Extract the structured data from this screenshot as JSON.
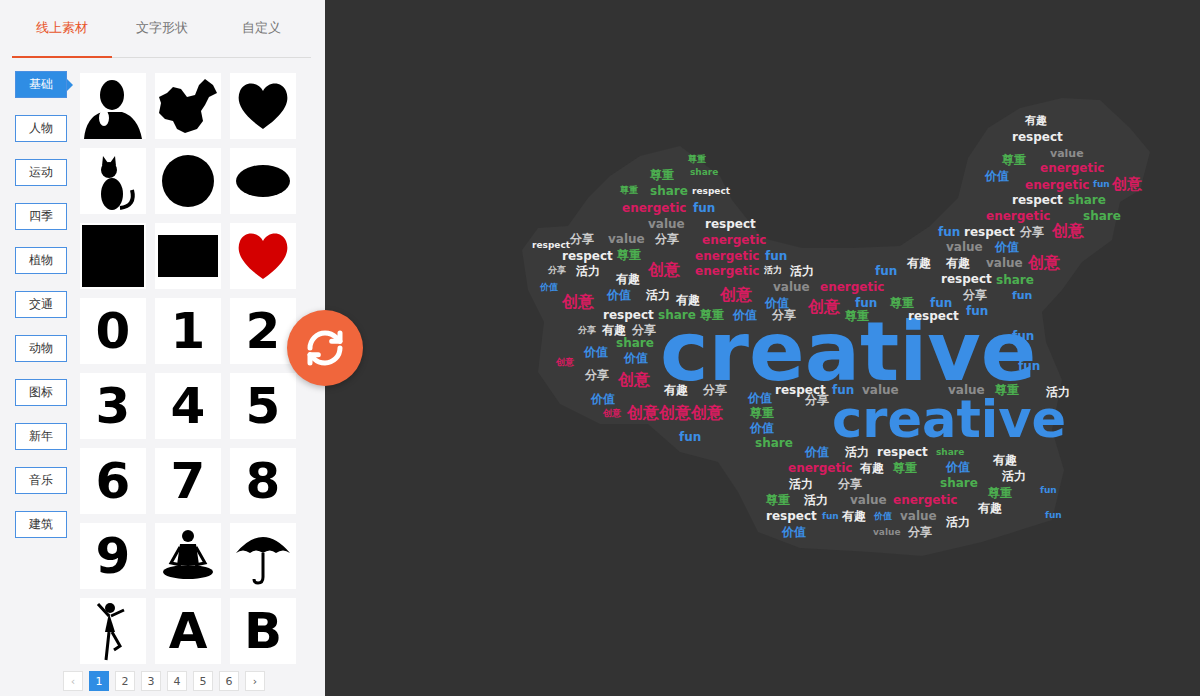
{
  "tabs": [
    {
      "label": "线上素材",
      "selected": true
    },
    {
      "label": "文字形状",
      "selected": false
    },
    {
      "label": "自定义",
      "selected": false
    }
  ],
  "categories": [
    {
      "label": "基础",
      "selected": true
    },
    {
      "label": "人物",
      "selected": false
    },
    {
      "label": "运动",
      "selected": false
    },
    {
      "label": "四季",
      "selected": false
    },
    {
      "label": "植物",
      "selected": false
    },
    {
      "label": "交通",
      "selected": false
    },
    {
      "label": "动物",
      "selected": false
    },
    {
      "label": "图标",
      "selected": false
    },
    {
      "label": "新年",
      "selected": false
    },
    {
      "label": "音乐",
      "selected": false
    },
    {
      "label": "建筑",
      "selected": false
    }
  ],
  "shapes": [
    {
      "kind": "person",
      "color": "#000000"
    },
    {
      "kind": "map",
      "color": "#000000"
    },
    {
      "kind": "heart",
      "color": "#000000"
    },
    {
      "kind": "cat",
      "color": "#000000"
    },
    {
      "kind": "circle",
      "color": "#000000"
    },
    {
      "kind": "ellipse",
      "color": "#000000"
    },
    {
      "kind": "square",
      "color": "#000000"
    },
    {
      "kind": "rect",
      "color": "#000000"
    },
    {
      "kind": "heart",
      "color": "#d40000"
    },
    {
      "kind": "glyph",
      "text": "0",
      "color": "#000000"
    },
    {
      "kind": "glyph",
      "text": "1",
      "color": "#000000"
    },
    {
      "kind": "glyph",
      "text": "2",
      "color": "#000000"
    },
    {
      "kind": "glyph",
      "text": "3",
      "color": "#000000"
    },
    {
      "kind": "glyph",
      "text": "4",
      "color": "#000000"
    },
    {
      "kind": "glyph",
      "text": "5",
      "color": "#000000"
    },
    {
      "kind": "glyph",
      "text": "6",
      "color": "#000000"
    },
    {
      "kind": "glyph",
      "text": "7",
      "color": "#000000"
    },
    {
      "kind": "glyph",
      "text": "8",
      "color": "#000000"
    },
    {
      "kind": "glyph",
      "text": "9",
      "color": "#000000"
    },
    {
      "kind": "yogi",
      "color": "#000000"
    },
    {
      "kind": "umbrella",
      "color": "#000000"
    },
    {
      "kind": "dancer",
      "color": "#000000"
    },
    {
      "kind": "glyph",
      "text": "A",
      "color": "#000000"
    },
    {
      "kind": "glyph",
      "text": "B",
      "color": "#000000"
    }
  ],
  "pagination": {
    "prev": "‹",
    "prev_disabled": true,
    "next": "›",
    "next_disabled": false,
    "pages": [
      {
        "label": "1",
        "selected": true
      },
      {
        "label": "2",
        "selected": false
      },
      {
        "label": "3",
        "selected": false
      },
      {
        "label": "4",
        "selected": false
      },
      {
        "label": "5",
        "selected": false
      },
      {
        "label": "6",
        "selected": false
      }
    ]
  },
  "cloud": {
    "words": [
      {
        "text": "creative",
        "color": "#3a8ee6"
      },
      {
        "text": "creative",
        "color": "#3a8ee6"
      },
      {
        "text": "有趣",
        "color": "#eeeeee"
      },
      {
        "text": "respect",
        "color": "#eeeeee"
      },
      {
        "text": "尊重",
        "color": "#4caf50"
      },
      {
        "text": "value",
        "color": "#8c8c8c"
      },
      {
        "text": "energetic",
        "color": "#d81b60"
      },
      {
        "text": "价值",
        "color": "#3a8ee6"
      },
      {
        "text": "energetic",
        "color": "#d81b60"
      },
      {
        "text": "fun",
        "color": "#3a8ee6"
      },
      {
        "text": "创意",
        "color": "#d81b60"
      },
      {
        "text": "respect",
        "color": "#eeeeee"
      },
      {
        "text": "share",
        "color": "#4caf50"
      },
      {
        "text": "energetic",
        "color": "#d81b60"
      },
      {
        "text": "share",
        "color": "#4caf50"
      },
      {
        "text": "fun",
        "color": "#3a8ee6"
      },
      {
        "text": "respect",
        "color": "#eeeeee"
      },
      {
        "text": "分享",
        "color": "#cccccc"
      },
      {
        "text": "创意",
        "color": "#d81b60"
      },
      {
        "text": "价值",
        "color": "#3a8ee6"
      },
      {
        "text": "value",
        "color": "#8c8c8c"
      },
      {
        "text": "有趣",
        "color": "#eeeeee"
      },
      {
        "text": "value",
        "color": "#8c8c8c"
      },
      {
        "text": "创意",
        "color": "#d81b60"
      },
      {
        "text": "respect",
        "color": "#eeeeee"
      },
      {
        "text": "share",
        "color": "#4caf50"
      },
      {
        "text": "分享",
        "color": "#cccccc"
      },
      {
        "text": "fun",
        "color": "#3a8ee6"
      },
      {
        "text": "fun",
        "color": "#3a8ee6"
      },
      {
        "text": "尊重",
        "color": "#4caf50"
      },
      {
        "text": "share",
        "color": "#4caf50"
      },
      {
        "text": "尊重",
        "color": "#4caf50"
      },
      {
        "text": "尊重",
        "color": "#4caf50"
      },
      {
        "text": "share",
        "color": "#4caf50"
      },
      {
        "text": "respect",
        "color": "#eeeeee"
      },
      {
        "text": "energetic",
        "color": "#d81b60"
      },
      {
        "text": "fun",
        "color": "#3a8ee6"
      },
      {
        "text": "respect",
        "color": "#eeeeee"
      },
      {
        "text": "value",
        "color": "#8c8c8c"
      },
      {
        "text": "分享",
        "color": "#cccccc"
      },
      {
        "text": "value",
        "color": "#8c8c8c"
      },
      {
        "text": "分享",
        "color": "#cccccc"
      },
      {
        "text": "energetic",
        "color": "#d81b60"
      },
      {
        "text": "respect",
        "color": "#eeeeee"
      },
      {
        "text": "respect",
        "color": "#eeeeee"
      },
      {
        "text": "尊重",
        "color": "#4caf50"
      },
      {
        "text": "创意",
        "color": "#d81b60"
      },
      {
        "text": "energetic",
        "color": "#d81b60"
      },
      {
        "text": "fun",
        "color": "#3a8ee6"
      },
      {
        "text": "分享",
        "color": "#cccccc"
      },
      {
        "text": "活力",
        "color": "#eeeeee"
      },
      {
        "text": "有趣",
        "color": "#eeeeee"
      },
      {
        "text": "energetic",
        "color": "#d81b60"
      },
      {
        "text": "活力",
        "color": "#eeeeee"
      },
      {
        "text": "活力",
        "color": "#eeeeee"
      },
      {
        "text": "fun",
        "color": "#3a8ee6"
      },
      {
        "text": "有趣",
        "color": "#eeeeee"
      },
      {
        "text": "价值",
        "color": "#3a8ee6"
      },
      {
        "text": "价值",
        "color": "#3a8ee6"
      },
      {
        "text": "活力",
        "color": "#eeeeee"
      },
      {
        "text": "创意",
        "color": "#d81b60"
      },
      {
        "text": "value",
        "color": "#8c8c8c"
      },
      {
        "text": "energetic",
        "color": "#d81b60"
      },
      {
        "text": "创意",
        "color": "#d81b60"
      },
      {
        "text": "有趣",
        "color": "#eeeeee"
      },
      {
        "text": "价值",
        "color": "#3a8ee6"
      },
      {
        "text": "创意",
        "color": "#d81b60"
      },
      {
        "text": "fun",
        "color": "#3a8ee6"
      },
      {
        "text": "尊重",
        "color": "#4caf50"
      },
      {
        "text": "fun",
        "color": "#3a8ee6"
      },
      {
        "text": "respect",
        "color": "#eeeeee"
      },
      {
        "text": "share",
        "color": "#4caf50"
      },
      {
        "text": "尊重",
        "color": "#4caf50"
      },
      {
        "text": "价值",
        "color": "#3a8ee6"
      },
      {
        "text": "分享",
        "color": "#cccccc"
      },
      {
        "text": "尊重",
        "color": "#4caf50"
      },
      {
        "text": "respect",
        "color": "#eeeeee"
      },
      {
        "text": "分享",
        "color": "#cccccc"
      },
      {
        "text": "有趣",
        "color": "#eeeeee"
      },
      {
        "text": "分享",
        "color": "#cccccc"
      },
      {
        "text": "share",
        "color": "#4caf50"
      },
      {
        "text": "价值",
        "color": "#3a8ee6"
      },
      {
        "text": "价值",
        "color": "#3a8ee6"
      },
      {
        "text": "创意",
        "color": "#d81b60"
      },
      {
        "text": "分享",
        "color": "#cccccc"
      },
      {
        "text": "创意",
        "color": "#d81b60"
      },
      {
        "text": "有趣",
        "color": "#eeeeee"
      },
      {
        "text": "分享",
        "color": "#cccccc"
      },
      {
        "text": "respect",
        "color": "#eeeeee"
      },
      {
        "text": "fun",
        "color": "#3a8ee6"
      },
      {
        "text": "value",
        "color": "#8c8c8c"
      },
      {
        "text": "value",
        "color": "#8c8c8c"
      },
      {
        "text": "尊重",
        "color": "#4caf50"
      },
      {
        "text": "fun",
        "color": "#3a8ee6"
      },
      {
        "text": "fun",
        "color": "#3a8ee6"
      },
      {
        "text": "价值",
        "color": "#3a8ee6"
      },
      {
        "text": "创意",
        "color": "#d81b60"
      },
      {
        "text": "创意",
        "color": "#d81b60"
      },
      {
        "text": "创意",
        "color": "#d81b60"
      },
      {
        "text": "创意",
        "color": "#d81b60"
      },
      {
        "text": "价值",
        "color": "#3a8ee6"
      },
      {
        "text": "尊重",
        "color": "#4caf50"
      },
      {
        "text": "价值",
        "color": "#3a8ee6"
      },
      {
        "text": "分享",
        "color": "#cccccc"
      },
      {
        "text": "fun",
        "color": "#3a8ee6"
      },
      {
        "text": "share",
        "color": "#4caf50"
      },
      {
        "text": "价值",
        "color": "#3a8ee6"
      },
      {
        "text": "活力",
        "color": "#eeeeee"
      },
      {
        "text": "respect",
        "color": "#eeeeee"
      },
      {
        "text": "share",
        "color": "#4caf50"
      },
      {
        "text": "价值",
        "color": "#3a8ee6"
      },
      {
        "text": "有趣",
        "color": "#eeeeee"
      },
      {
        "text": "尊重",
        "color": "#4caf50"
      },
      {
        "text": "有趣",
        "color": "#eeeeee"
      },
      {
        "text": "energetic",
        "color": "#d81b60"
      },
      {
        "text": "活力",
        "color": "#eeeeee"
      },
      {
        "text": "share",
        "color": "#4caf50"
      },
      {
        "text": "尊重",
        "color": "#4caf50"
      },
      {
        "text": "fun",
        "color": "#3a8ee6"
      },
      {
        "text": "活力",
        "color": "#eeeeee"
      },
      {
        "text": "分享",
        "color": "#cccccc"
      },
      {
        "text": "value",
        "color": "#8c8c8c"
      },
      {
        "text": "energetic",
        "color": "#d81b60"
      },
      {
        "text": "尊重",
        "color": "#4caf50"
      },
      {
        "text": "活力",
        "color": "#eeeeee"
      },
      {
        "text": "有趣",
        "color": "#eeeeee"
      },
      {
        "text": "respect",
        "color": "#eeeeee"
      },
      {
        "text": "fun",
        "color": "#3a8ee6"
      },
      {
        "text": "有趣",
        "color": "#eeeeee"
      },
      {
        "text": "价值",
        "color": "#3a8ee6"
      },
      {
        "text": "value",
        "color": "#8c8c8c"
      },
      {
        "text": "活力",
        "color": "#eeeeee"
      },
      {
        "text": "fun",
        "color": "#3a8ee6"
      },
      {
        "text": "价值",
        "color": "#3a8ee6"
      },
      {
        "text": "value",
        "color": "#8c8c8c"
      },
      {
        "text": "分享",
        "color": "#cccccc"
      },
      {
        "text": "活力",
        "color": "#eeeeee"
      }
    ]
  }
}
